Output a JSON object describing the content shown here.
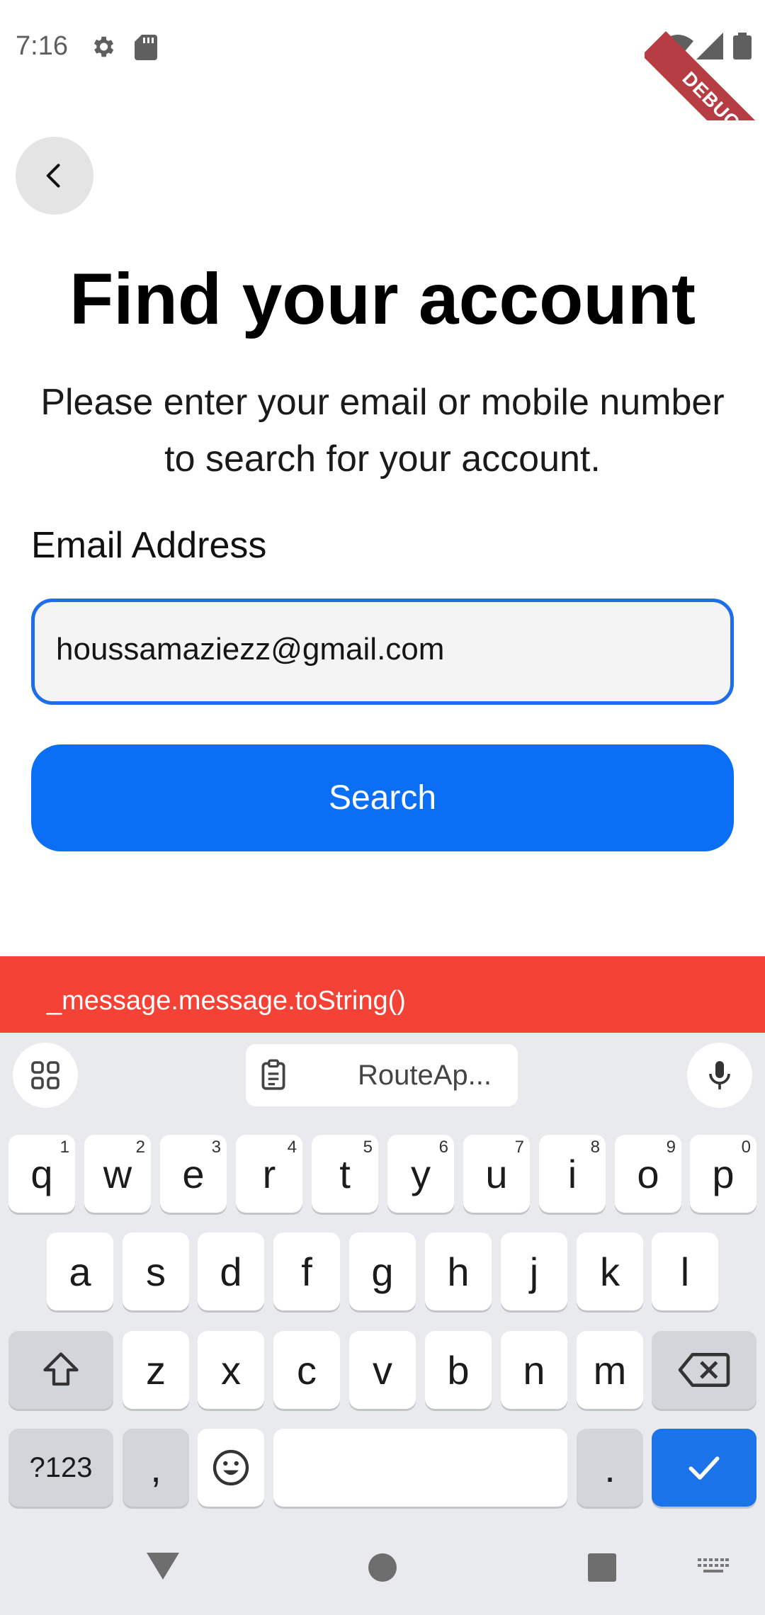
{
  "status_bar": {
    "time": "7:16",
    "icons": [
      "gear-icon",
      "sd-card-icon",
      "wifi-icon",
      "signal-icon",
      "battery-icon"
    ],
    "debug_label": "DEBUG"
  },
  "header": {
    "back_icon": "chevron-left-icon",
    "title": "Find your account",
    "subtitle_line1": "Please enter your email or mobile number",
    "subtitle_line2": "to search for your account."
  },
  "form": {
    "email_label": "Email Address",
    "email_value": "houssamaziezz@gmail.com",
    "search_label": "Search"
  },
  "snackbar": {
    "message": "_message.message.toString()",
    "color": "#f44336"
  },
  "keyboard": {
    "clipboard_text": "RouteAp...",
    "row1": [
      {
        "label": "q",
        "hint": "1"
      },
      {
        "label": "w",
        "hint": "2"
      },
      {
        "label": "e",
        "hint": "3"
      },
      {
        "label": "r",
        "hint": "4"
      },
      {
        "label": "t",
        "hint": "5"
      },
      {
        "label": "y",
        "hint": "6"
      },
      {
        "label": "u",
        "hint": "7"
      },
      {
        "label": "i",
        "hint": "8"
      },
      {
        "label": "o",
        "hint": "9"
      },
      {
        "label": "p",
        "hint": "0"
      }
    ],
    "row2": [
      "a",
      "s",
      "d",
      "f",
      "g",
      "h",
      "j",
      "k",
      "l"
    ],
    "row3": [
      "z",
      "x",
      "c",
      "v",
      "b",
      "n",
      "m"
    ],
    "symbols_label": "?123",
    "comma_label": ",",
    "period_label": "."
  },
  "colors": {
    "accent": "#0b6ff5",
    "field_border": "#1d6ee8",
    "enter_key": "#1a73e8"
  }
}
